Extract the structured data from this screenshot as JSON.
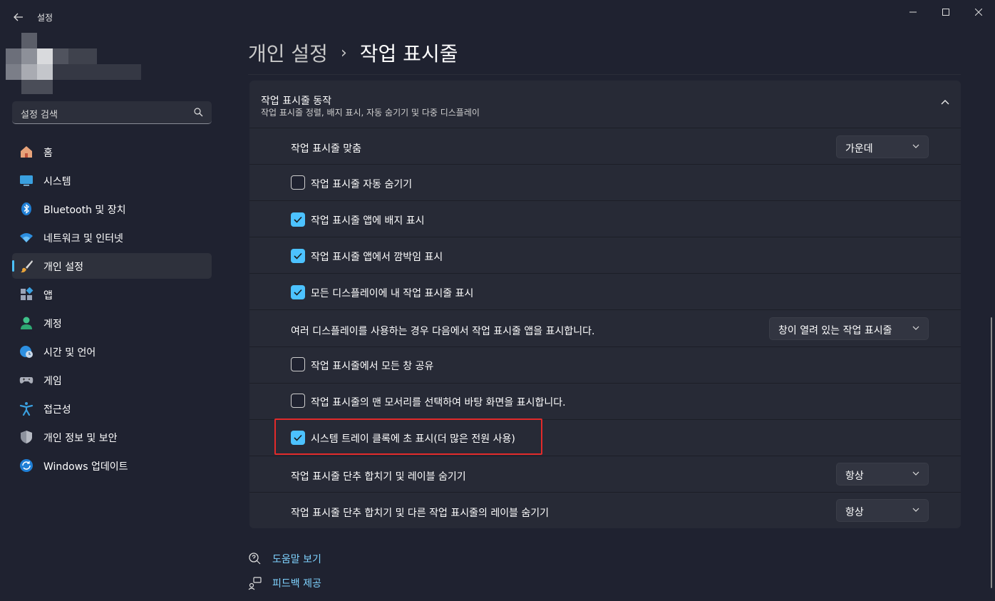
{
  "window": {
    "title": "설정"
  },
  "sidebar": {
    "search_placeholder": "설정 검색",
    "items": [
      {
        "label": "홈",
        "icon": "home-icon"
      },
      {
        "label": "시스템",
        "icon": "system-icon"
      },
      {
        "label": "Bluetooth 및 장치",
        "icon": "bluetooth-icon"
      },
      {
        "label": "네트워크 및 인터넷",
        "icon": "wifi-icon"
      },
      {
        "label": "개인 설정",
        "icon": "brush-icon",
        "active": true
      },
      {
        "label": "앱",
        "icon": "apps-icon"
      },
      {
        "label": "계정",
        "icon": "account-icon"
      },
      {
        "label": "시간 및 언어",
        "icon": "globe-clock-icon"
      },
      {
        "label": "게임",
        "icon": "gamepad-icon"
      },
      {
        "label": "접근성",
        "icon": "accessibility-icon"
      },
      {
        "label": "개인 정보 및 보안",
        "icon": "shield-icon"
      },
      {
        "label": "Windows 업데이트",
        "icon": "update-icon"
      }
    ]
  },
  "breadcrumb": {
    "parent": "개인 설정",
    "separator": "›",
    "current": "작업 표시줄"
  },
  "section": {
    "title": "작업 표시줄 동작",
    "subtitle": "작업 표시줄 정렬, 배지 표시, 자동 숨기기 및 다중 디스플레이",
    "rows": [
      {
        "type": "dropdown",
        "label": "작업 표시줄 맞춤",
        "value": "가운데"
      },
      {
        "type": "checkbox",
        "label": "작업 표시줄 자동 숨기기",
        "checked": false
      },
      {
        "type": "checkbox",
        "label": "작업 표시줄 앱에 배지 표시",
        "checked": true
      },
      {
        "type": "checkbox",
        "label": "작업 표시줄 앱에서 깜박임 표시",
        "checked": true
      },
      {
        "type": "checkbox",
        "label": "모든 디스플레이에 내 작업 표시줄 표시",
        "checked": true
      },
      {
        "type": "dropdown",
        "label": "여러 디스플레이를 사용하는 경우 다음에서 작업 표시줄 앱을 표시합니다.",
        "value": "창이 열려 있는 작업 표시줄"
      },
      {
        "type": "checkbox",
        "label": "작업 표시줄에서 모든 창 공유",
        "checked": false
      },
      {
        "type": "checkbox",
        "label": "작업 표시줄의 맨 모서리를 선택하여 바탕 화면을 표시합니다.",
        "checked": false
      },
      {
        "type": "checkbox",
        "label": "시스템 트레이 클록에 초 표시(더 많은 전원 사용)",
        "checked": true
      },
      {
        "type": "dropdown",
        "label": "작업 표시줄 단추 합치기 및 레이블 숨기기",
        "value": "항상"
      },
      {
        "type": "dropdown",
        "label": "작업 표시줄 단추 합치기 및 다른 작업 표시줄의 레이블 숨기기",
        "value": "항상"
      }
    ]
  },
  "links": {
    "help": "도움말 보기",
    "feedback": "피드백 제공"
  },
  "colors": {
    "background": "#1f2230",
    "panel": "#272a36",
    "accent": "#4cc2ff",
    "highlight": "#e22a2a",
    "link": "#7fd3ff"
  }
}
